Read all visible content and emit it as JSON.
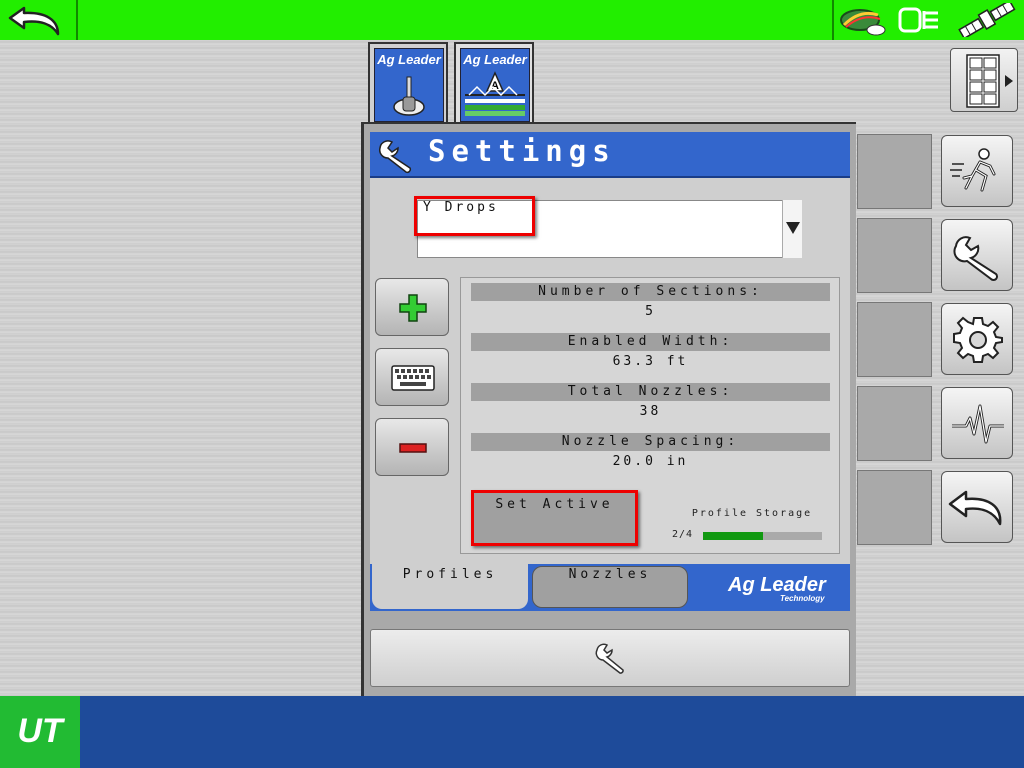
{
  "header": {
    "title": "Settings"
  },
  "vt_tabs": [
    {
      "brand": "Ag Leader"
    },
    {
      "brand": "Ag Leader"
    }
  ],
  "profile": {
    "selected": "Y Drops"
  },
  "info": {
    "sections_label": "Number of Sections:",
    "sections_value": "5",
    "width_label": "Enabled Width:",
    "width_value": "63.3 ft",
    "nozzles_label": "Total Nozzles:",
    "nozzles_value": "38",
    "spacing_label": "Nozzle Spacing:",
    "spacing_value": "20.0 in"
  },
  "actions": {
    "set_active": "Set Active"
  },
  "storage": {
    "label": "Profile Storage",
    "count": "2/4",
    "used_fraction": 0.5
  },
  "tabs": {
    "profiles": "Profiles",
    "nozzles": "Nozzles"
  },
  "brand": {
    "name": "Ag Leader",
    "sub": "Technology"
  },
  "taskbar": {
    "logo": "UT"
  },
  "colors": {
    "topbar": "#22ee00",
    "header_blue": "#3366cc",
    "highlight_red": "#ee0000",
    "storage_fill": "#119911",
    "taskbar": "#1e4b9a"
  },
  "icons": [
    "back-arrow-icon",
    "spray-status-icon",
    "isobus-icon",
    "satellite-icon",
    "grid-menu-icon",
    "wrench-icon",
    "plus-icon",
    "keyboard-icon",
    "minus-icon",
    "running-man-icon",
    "gear-icon",
    "pulse-icon"
  ]
}
